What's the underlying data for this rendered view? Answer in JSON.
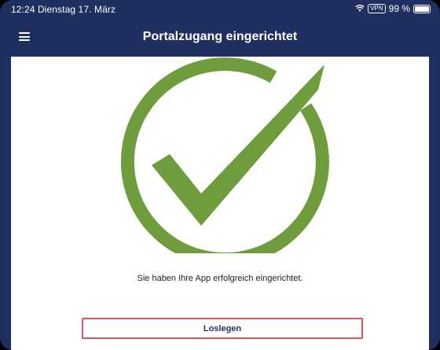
{
  "status_bar": {
    "time_date": "12:24  Dienstag 17. März",
    "vpn_label": "VPN",
    "battery_text": "99 %",
    "battery_level_percent": 99
  },
  "header": {
    "title": "Portalzugang eingerichtet",
    "menu_icon": "hamburger-menu-icon"
  },
  "main": {
    "success_icon": "checkmark-circle-icon",
    "message": "Sie haben Ihre App erfolgreich eingerichtet.",
    "primary_button_label": "Loslegen"
  },
  "colors": {
    "header_bg": "#1f2f5f",
    "check_green": "#6f9d3e",
    "button_border": "#e0525e"
  }
}
